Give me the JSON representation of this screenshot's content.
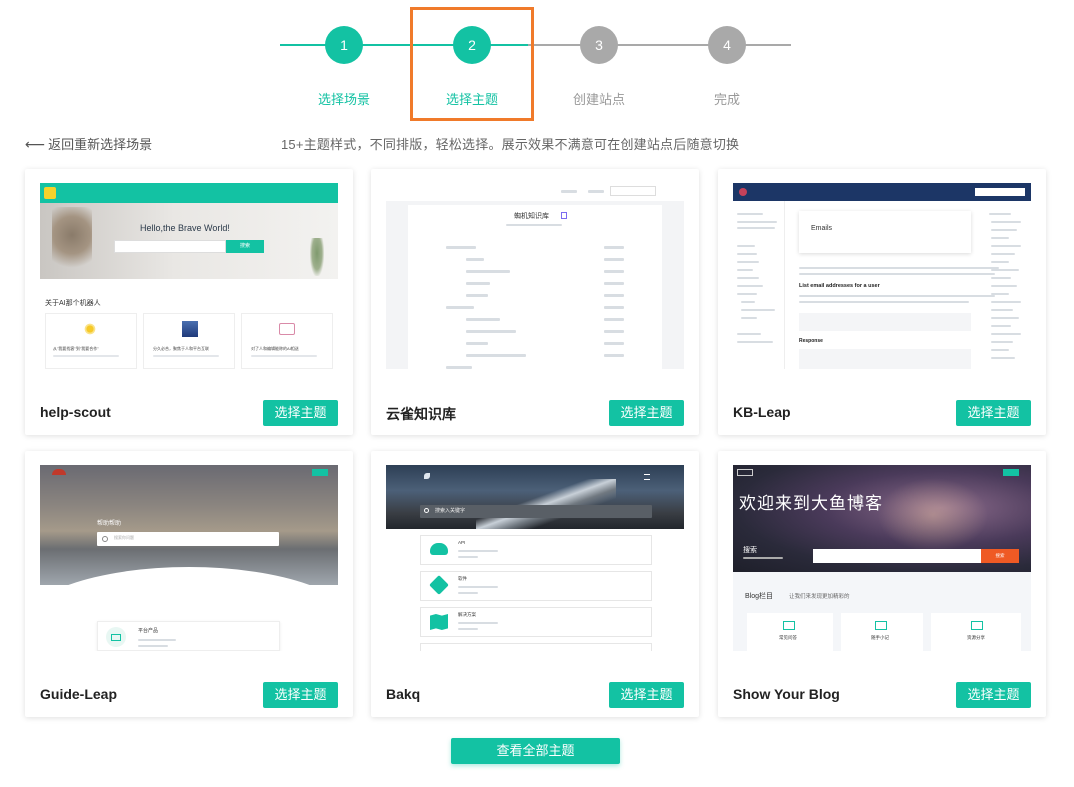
{
  "steps": [
    {
      "number": "1",
      "label": "选择场景",
      "state": "active"
    },
    {
      "number": "2",
      "label": "选择主题",
      "state": "active"
    },
    {
      "number": "3",
      "label": "创建站点",
      "state": "pending"
    },
    {
      "number": "4",
      "label": "完成",
      "state": "pending"
    }
  ],
  "back_link": "返回重新选择场景",
  "subtitle": "15+主题样式，不同排版，轻松选择。展示效果不满意可在创建站点后随意切换",
  "themes": [
    {
      "name": "help-scout",
      "button": "选择主题",
      "preview": {
        "hero_title": "Hello,the Brave World!",
        "search_button": "搜索",
        "section_title": "关于AI那个机器人",
        "items": [
          "从\"我要找客\"到\"我要合作\"",
          "分久必合，聚焦于人和平台互联",
          "对了人和编辑能称的AI相送"
        ]
      }
    },
    {
      "name": "云雀知识库",
      "button": "选择主题",
      "preview": {
        "title": "蜘机知识库"
      }
    },
    {
      "name": "KB-Leap",
      "button": "选择主题",
      "preview": {
        "card_title": "Emails",
        "heading": "List email addresses for a user",
        "section": "Response"
      }
    },
    {
      "name": "Guide-Leap",
      "button": "选择主题",
      "preview": {
        "hero_title": "帮助帮助",
        "search_placeholder": "搜索你问题",
        "list_title": "平台产品"
      }
    },
    {
      "name": "Bakq",
      "button": "选择主题",
      "preview": {
        "search_placeholder": "搜索入关键字",
        "items": [
          "API",
          "软件",
          "解决方案"
        ]
      }
    },
    {
      "name": "Show Your Blog",
      "button": "选择主题",
      "preview": {
        "hero_title": "欢迎来到大鱼博客",
        "search_label": "搜索",
        "search_button": "搜索",
        "section_title": "Blog栏目",
        "section_desc": "让我们来发现更加精彩的",
        "items": [
          "常见问答",
          "随手小记",
          "资源分享"
        ]
      }
    }
  ],
  "view_all": "查看全部主题",
  "colors": {
    "accent": "#13c2a3",
    "pending": "#a9a9a9",
    "highlight": "#f07a2a"
  }
}
